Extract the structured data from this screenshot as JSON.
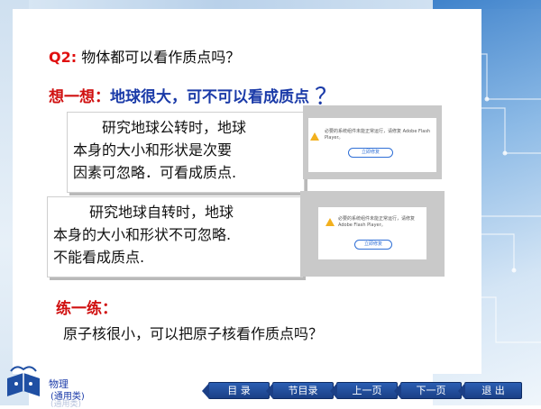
{
  "slide": {
    "q2_tag": "Q2:",
    "q2_text": "物体都可以看作质点吗？",
    "think_label": "想一想：",
    "think_text": "地球很大，可不可以看成质点",
    "think_qmark": "？",
    "box1_lines": [
      "研究地球公转时，地球",
      "本身的大小和形状是次要",
      "因素可忽略．可看成质点."
    ],
    "box2_lines": [
      "研究地球自转时，地球",
      "本身的大小和形状不可忽略.",
      "不能看成质点."
    ],
    "practice_label": "练一练：",
    "practice_question": "原子核很小，可以把原子核看作质点吗？"
  },
  "flash_notice_1": {
    "text": "必要的系统组件未能正常运行，请修复 Adobe Flash Player。",
    "button": "立即修复"
  },
  "flash_notice_2": {
    "text": "必要的系统组件未能正常运行，请修复 Adobe Flash Player。",
    "button": "立即修复"
  },
  "footer": {
    "subject": "物理",
    "subject_sub": "(通用类)",
    "subject_ghost": "(通用类)"
  },
  "nav": {
    "items": [
      "目 录",
      "节目录",
      "上一页",
      "下一页",
      "退 出"
    ]
  },
  "colors": {
    "accent_red": "#d01010",
    "accent_blue": "#1a3aa8",
    "nav_blue": "#2b5fb3",
    "flash_button": "#2f6fd6"
  }
}
